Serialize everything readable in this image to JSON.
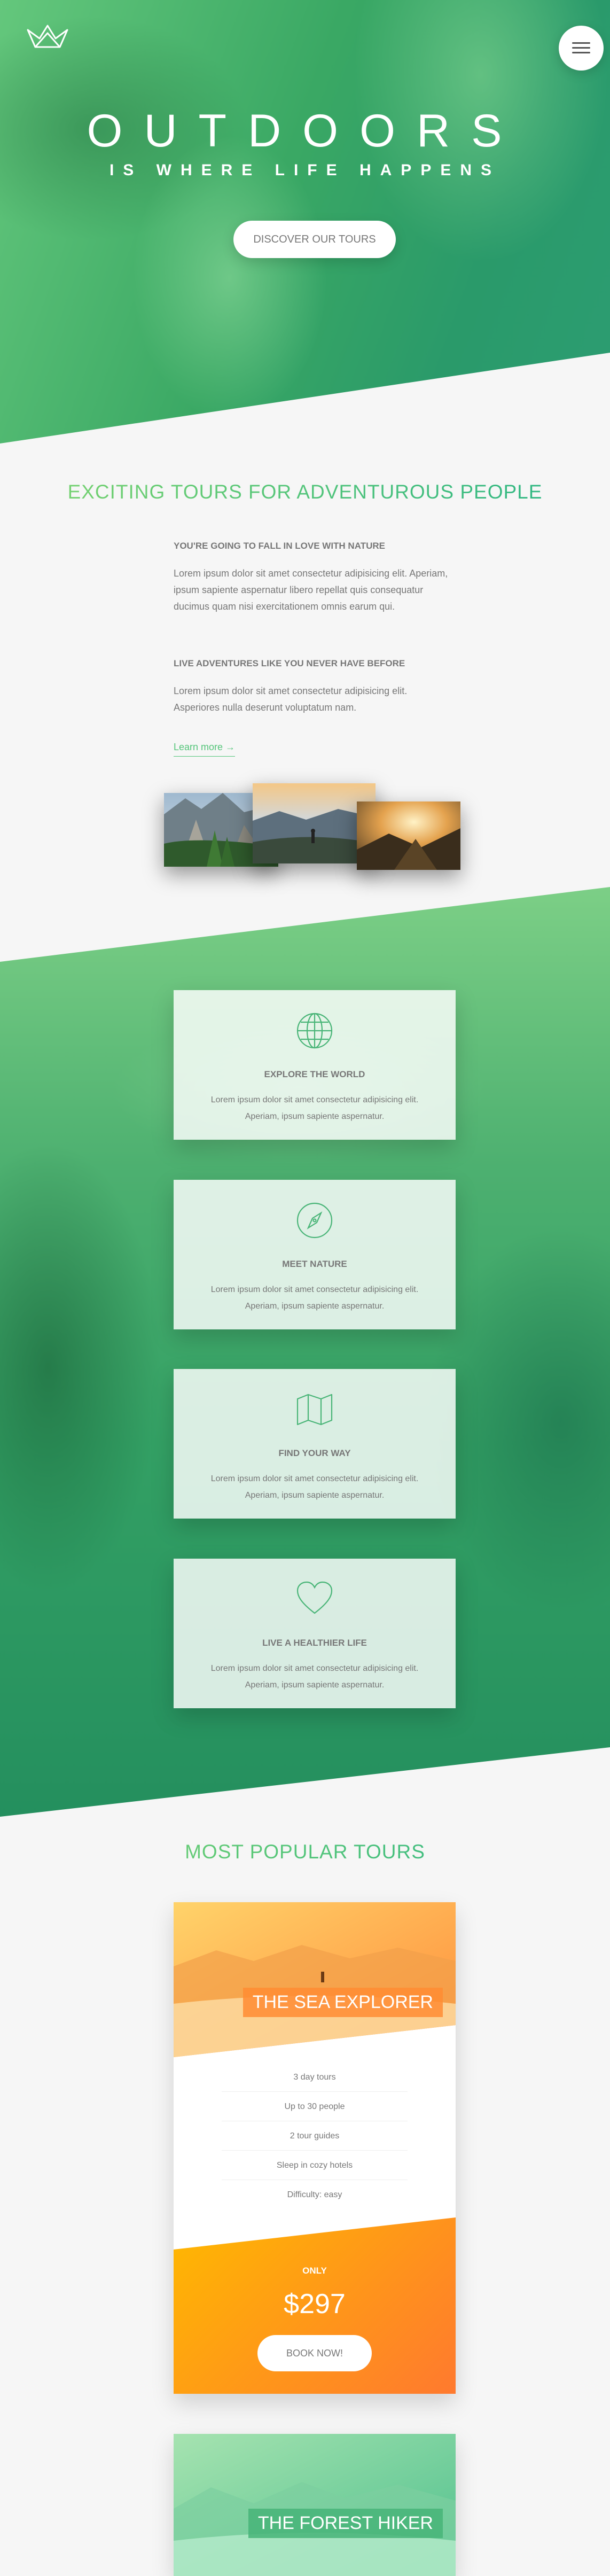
{
  "hero": {
    "title": "OUTDOORS",
    "subtitle": "IS WHERE LIFE HAPPENS",
    "cta_label": "DISCOVER OUR TOURS",
    "logo_icon": "crown-logo-icon",
    "menu_icon": "hamburger-menu-icon"
  },
  "about": {
    "title": "EXCITING TOURS FOR ADVENTUROUS PEOPLE",
    "heading1": "YOU'RE GOING TO FALL IN LOVE WITH NATURE",
    "text1": "Lorem ipsum dolor sit amet consectetur adipisicing elit. Aperiam, ipsum sapiente aspernatur libero repellat quis consequatur ducimus quam nisi exercitationem omnis earum qui.",
    "heading2": "LIVE ADVENTURES LIKE YOU NEVER HAVE BEFORE",
    "text2": "Lorem ipsum dolor sit amet consectetur adipisicing elit. Asperiores nulla deserunt voluptatum nam.",
    "link_label": "Learn more →"
  },
  "features": [
    {
      "icon": "globe-icon",
      "title": "EXPLORE THE WORLD",
      "text": "Lorem ipsum dolor sit amet consectetur adipisicing elit. Aperiam, ipsum sapiente aspernatur."
    },
    {
      "icon": "compass-icon",
      "title": "MEET NATURE",
      "text": "Lorem ipsum dolor sit amet consectetur adipisicing elit. Aperiam, ipsum sapiente aspernatur."
    },
    {
      "icon": "map-icon",
      "title": "FIND YOUR WAY",
      "text": "Lorem ipsum dolor sit amet consectetur adipisicing elit. Aperiam, ipsum sapiente aspernatur."
    },
    {
      "icon": "heart-icon",
      "title": "LIVE A HEALTHIER LIFE",
      "text": "Lorem ipsum dolor sit amet consectetur adipisicing elit. Aperiam, ipsum sapiente aspernatur."
    }
  ],
  "tours": {
    "title": "MOST POPULAR TOURS",
    "cards": [
      {
        "heading": "THE SEA EXPLORER",
        "details": [
          "3 day tours",
          "Up to 30 people",
          "2 tour guides",
          "Sleep in cozy hotels",
          "Difficulty: easy"
        ],
        "price_label": "ONLY",
        "price": "$297",
        "button_label": "BOOK NOW!"
      },
      {
        "heading": "THE FOREST HIKER"
      }
    ]
  },
  "colors": {
    "primary_light": "#7ed56f",
    "primary_dark": "#28b485",
    "secondary_light": "#ffb900",
    "secondary_dark": "#ff7730"
  }
}
